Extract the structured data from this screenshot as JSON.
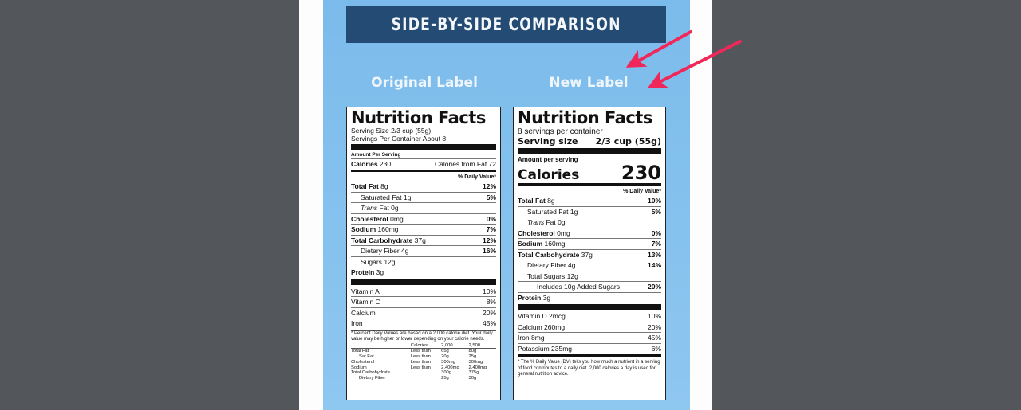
{
  "banner": {
    "title": "SIDE-BY-SIDE COMPARISON"
  },
  "columns": {
    "original": "Original Label",
    "new": "New Label"
  },
  "colors": {
    "background": "#53565a",
    "panel": "#7bbbeb",
    "banner": "#244b74",
    "arrow": "#f0285a"
  },
  "original_label": {
    "title": "Nutrition Facts",
    "serving_size": "Serving Size 2/3 cup (55g)",
    "servings_per_container": "Servings Per Container About 8",
    "amount_per_serving": "Amount Per Serving",
    "calories_label": "Calories",
    "calories_value": "230",
    "calories_from_fat": "Calories from Fat 72",
    "daily_value_header": "% Daily Value*",
    "nutrients": [
      {
        "name": "Total Fat",
        "amount": "8g",
        "dv": "12%",
        "bold": true,
        "indent": 0
      },
      {
        "name": "Saturated Fat",
        "amount": "1g",
        "dv": "5%",
        "bold": false,
        "indent": 1
      },
      {
        "name": "Trans",
        "name_suffix": "Fat 0g",
        "amount": "",
        "dv": "",
        "bold": false,
        "indent": 1
      },
      {
        "name": "Cholesterol",
        "amount": "0mg",
        "dv": "0%",
        "bold": true,
        "indent": 0
      },
      {
        "name": "Sodium",
        "amount": "160mg",
        "dv": "7%",
        "bold": true,
        "indent": 0
      },
      {
        "name": "Total Carbohydrate",
        "amount": "37g",
        "dv": "12%",
        "bold": true,
        "indent": 0
      },
      {
        "name": "Dietary Fiber",
        "amount": "4g",
        "dv": "16%",
        "bold": false,
        "indent": 1
      },
      {
        "name": "Sugars",
        "amount": "12g",
        "dv": "",
        "bold": false,
        "indent": 1
      },
      {
        "name": "Protein",
        "amount": "3g",
        "dv": "",
        "bold": true,
        "indent": 0
      }
    ],
    "vitamins": [
      {
        "name": "Vitamin A",
        "dv": "10%"
      },
      {
        "name": "Vitamin C",
        "dv": "8%"
      },
      {
        "name": "Calcium",
        "dv": "20%"
      },
      {
        "name": "Iron",
        "dv": "45%"
      }
    ],
    "footnote": "* Percent Daily Values are based on a 2,000 calorie diet. Your daily value may be higher or lower depending on your calorie needs.",
    "footnote_table": {
      "header": [
        "",
        "Calories:",
        "2,000",
        "2,500"
      ],
      "rows": [
        [
          "Total Fat",
          "Less than",
          "65g",
          "80g"
        ],
        [
          "Sat Fat",
          "Less than",
          "20g",
          "25g"
        ],
        [
          "Cholesterol",
          "Less than",
          "300mg",
          "300mg"
        ],
        [
          "Sodium",
          "Less than",
          "2,400mg",
          "2,400mg"
        ],
        [
          "Total Carbohydrate",
          "",
          "300g",
          "375g"
        ],
        [
          "Dietary Fiber",
          "",
          "25g",
          "30g"
        ]
      ]
    }
  },
  "new_label": {
    "title": "Nutrition Facts",
    "servings_per_container": "8 servings per container",
    "serving_size_label": "Serving size",
    "serving_size_value": "2/3 cup (55g)",
    "amount_per_serving": "Amount per serving",
    "calories_label": "Calories",
    "calories_value": "230",
    "daily_value_header": "% Daily Value*",
    "nutrients": [
      {
        "name": "Total Fat",
        "amount": "8g",
        "dv": "10%",
        "bold": true,
        "indent": 0
      },
      {
        "name": "Saturated Fat",
        "amount": "1g",
        "dv": "5%",
        "bold": false,
        "indent": 1
      },
      {
        "name": "Trans",
        "name_suffix": "Fat 0g",
        "amount": "",
        "dv": "",
        "bold": false,
        "indent": 1
      },
      {
        "name": "Cholesterol",
        "amount": "0mg",
        "dv": "0%",
        "bold": true,
        "indent": 0
      },
      {
        "name": "Sodium",
        "amount": "160mg",
        "dv": "7%",
        "bold": true,
        "indent": 0
      },
      {
        "name": "Total Carbohydrate",
        "amount": "37g",
        "dv": "13%",
        "bold": true,
        "indent": 0
      },
      {
        "name": "Dietary Fiber",
        "amount": "4g",
        "dv": "14%",
        "bold": false,
        "indent": 1
      },
      {
        "name": "Total Sugars",
        "amount": "12g",
        "dv": "",
        "bold": false,
        "indent": 1
      },
      {
        "name": "Includes 10g Added Sugars",
        "amount": "",
        "dv": "20%",
        "bold": false,
        "indent": 2
      },
      {
        "name": "Protein",
        "amount": "3g",
        "dv": "",
        "bold": true,
        "indent": 0
      }
    ],
    "vitamins": [
      {
        "name": "Vitamin D 2mcg",
        "dv": "10%"
      },
      {
        "name": "Calcium 260mg",
        "dv": "20%"
      },
      {
        "name": "Iron 8mg",
        "dv": "45%"
      },
      {
        "name": "Potassium 235mg",
        "dv": "6%"
      }
    ],
    "footnote": "* The % Daily Value (DV) tells you how much a nutrient in a serving of food contributes to a daily diet. 2,000 calories a day is used for general nutrition advice."
  }
}
